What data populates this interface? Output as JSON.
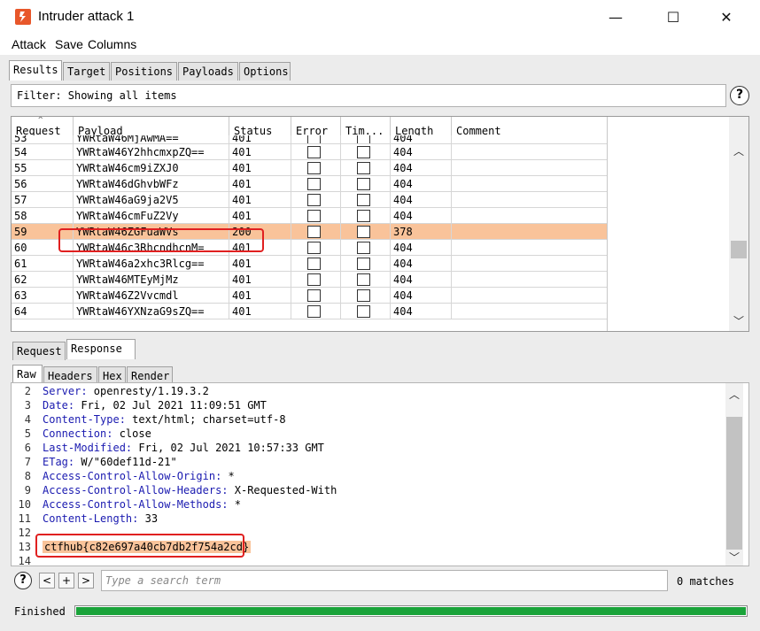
{
  "window": {
    "title": "Intruder attack 1"
  },
  "window_controls": {
    "minimize": "—",
    "maximize": "☐",
    "close": "✕"
  },
  "menu": [
    "Attack",
    "Save",
    "Columns"
  ],
  "main_tabs": [
    "Results",
    "Target",
    "Positions",
    "Payloads",
    "Options"
  ],
  "filter": {
    "text": "Filter: Showing all items"
  },
  "help_label": "?",
  "table": {
    "columns": [
      "Request",
      "Payload",
      "Status",
      "Error",
      "Tim...",
      "Length",
      "Comment"
    ],
    "partial_top_row": {
      "request": "53",
      "payload": "YWRtaW46MjAwMA==",
      "status": "401",
      "length": "404"
    },
    "rows": [
      {
        "request": "54",
        "payload": "YWRtaW46Y2hhcmxpZQ==",
        "status": "401",
        "length": "404"
      },
      {
        "request": "55",
        "payload": "YWRtaW46cm9iZXJ0",
        "status": "401",
        "length": "404"
      },
      {
        "request": "56",
        "payload": "YWRtaW46dGhvbWFz",
        "status": "401",
        "length": "404"
      },
      {
        "request": "57",
        "payload": "YWRtaW46aG9ja2V5",
        "status": "401",
        "length": "404"
      },
      {
        "request": "58",
        "payload": "YWRtaW46cmFuZ2Vy",
        "status": "401",
        "length": "404"
      },
      {
        "request": "59",
        "payload": "YWRtaW46ZGFuaWVs",
        "status": "200",
        "length": "378"
      },
      {
        "request": "60",
        "payload": "YWRtaW46c3RhcndhcnM=",
        "status": "401",
        "length": "404"
      },
      {
        "request": "61",
        "payload": "YWRtaW46a2xhc3Rlcg==",
        "status": "401",
        "length": "404"
      },
      {
        "request": "62",
        "payload": "YWRtaW46MTEyMjMz",
        "status": "401",
        "length": "404"
      },
      {
        "request": "63",
        "payload": "YWRtaW46Z2Vvcmdl",
        "status": "401",
        "length": "404"
      },
      {
        "request": "64",
        "payload": "YWRtaW46YXNzaG9sZQ==",
        "status": "401",
        "length": "404"
      }
    ],
    "highlighted_request": "59"
  },
  "detail_tabs": [
    "Request",
    "Response"
  ],
  "view_tabs": [
    "Raw",
    "Headers",
    "Hex",
    "Render"
  ],
  "response_lines": [
    {
      "n": "2",
      "key": "Server:",
      "val": " openresty/1.19.3.2"
    },
    {
      "n": "3",
      "key": "Date:",
      "val": " Fri, 02 Jul 2021 11:09:51 GMT"
    },
    {
      "n": "4",
      "key": "Content-Type:",
      "val": " text/html; charset=utf-8"
    },
    {
      "n": "5",
      "key": "Connection:",
      "val": " close"
    },
    {
      "n": "6",
      "key": "Last-Modified:",
      "val": " Fri, 02 Jul 2021 10:57:33 GMT"
    },
    {
      "n": "7",
      "key": "ETag:",
      "val": " W/\"60def11d-21\""
    },
    {
      "n": "8",
      "key": "Access-Control-Allow-Origin:",
      "val": " *"
    },
    {
      "n": "9",
      "key": "Access-Control-Allow-Headers:",
      "val": " X-Requested-With"
    },
    {
      "n": "10",
      "key": "Access-Control-Allow-Methods:",
      "val": " *"
    },
    {
      "n": "11",
      "key": "Content-Length:",
      "val": " 33"
    },
    {
      "n": "12",
      "key": "",
      "val": ""
    },
    {
      "n": "13",
      "key": "",
      "val": "ctfhub{c82e697a40cb7db2f754a2cd}"
    },
    {
      "n": "14",
      "key": "",
      "val": ""
    }
  ],
  "search": {
    "placeholder": "Type a search term",
    "matches": "0 matches",
    "buttons": [
      "?",
      "<",
      "+",
      ">"
    ]
  },
  "status": {
    "text": "Finished",
    "progress": 1.0
  },
  "colors": {
    "highlight": "#f9c39a",
    "progress": "#1aa33a",
    "annotation": "#e02020",
    "header_key": "#1a1ab0"
  }
}
